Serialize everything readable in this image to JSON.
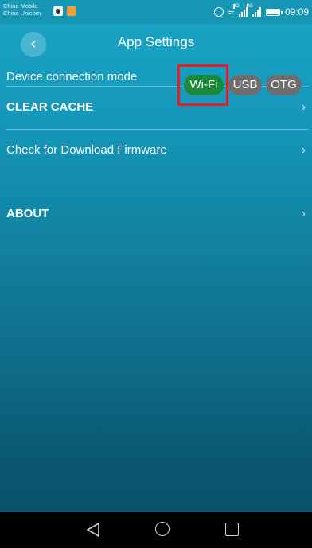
{
  "status_bar": {
    "carrier_1": "China Mobile",
    "carrier_2": "China Unicom",
    "time": "09:09",
    "signal_tag_1": "4G",
    "signal_tag_2": "2G"
  },
  "header": {
    "back_icon": "chevron-left-icon",
    "title": "App Settings"
  },
  "connection": {
    "label": "Device connection mode",
    "modes": [
      "Wi-Fi",
      "USB",
      "OTG"
    ],
    "selected": "Wi-Fi"
  },
  "menu": {
    "items": [
      {
        "label": "CLEAR CACHE",
        "icon": "chevron-right-icon"
      },
      {
        "label": "Check for Download Firmware",
        "icon": "chevron-right-icon"
      },
      {
        "label": "ABOUT",
        "icon": "chevron-right-icon"
      }
    ]
  },
  "colors": {
    "background_top": "#1aa5c6",
    "background_bottom": "#0a4f67",
    "selected_mode": "#1a8a3a",
    "unselected_mode": "#6d6d6d",
    "highlight": "#e31e24"
  }
}
